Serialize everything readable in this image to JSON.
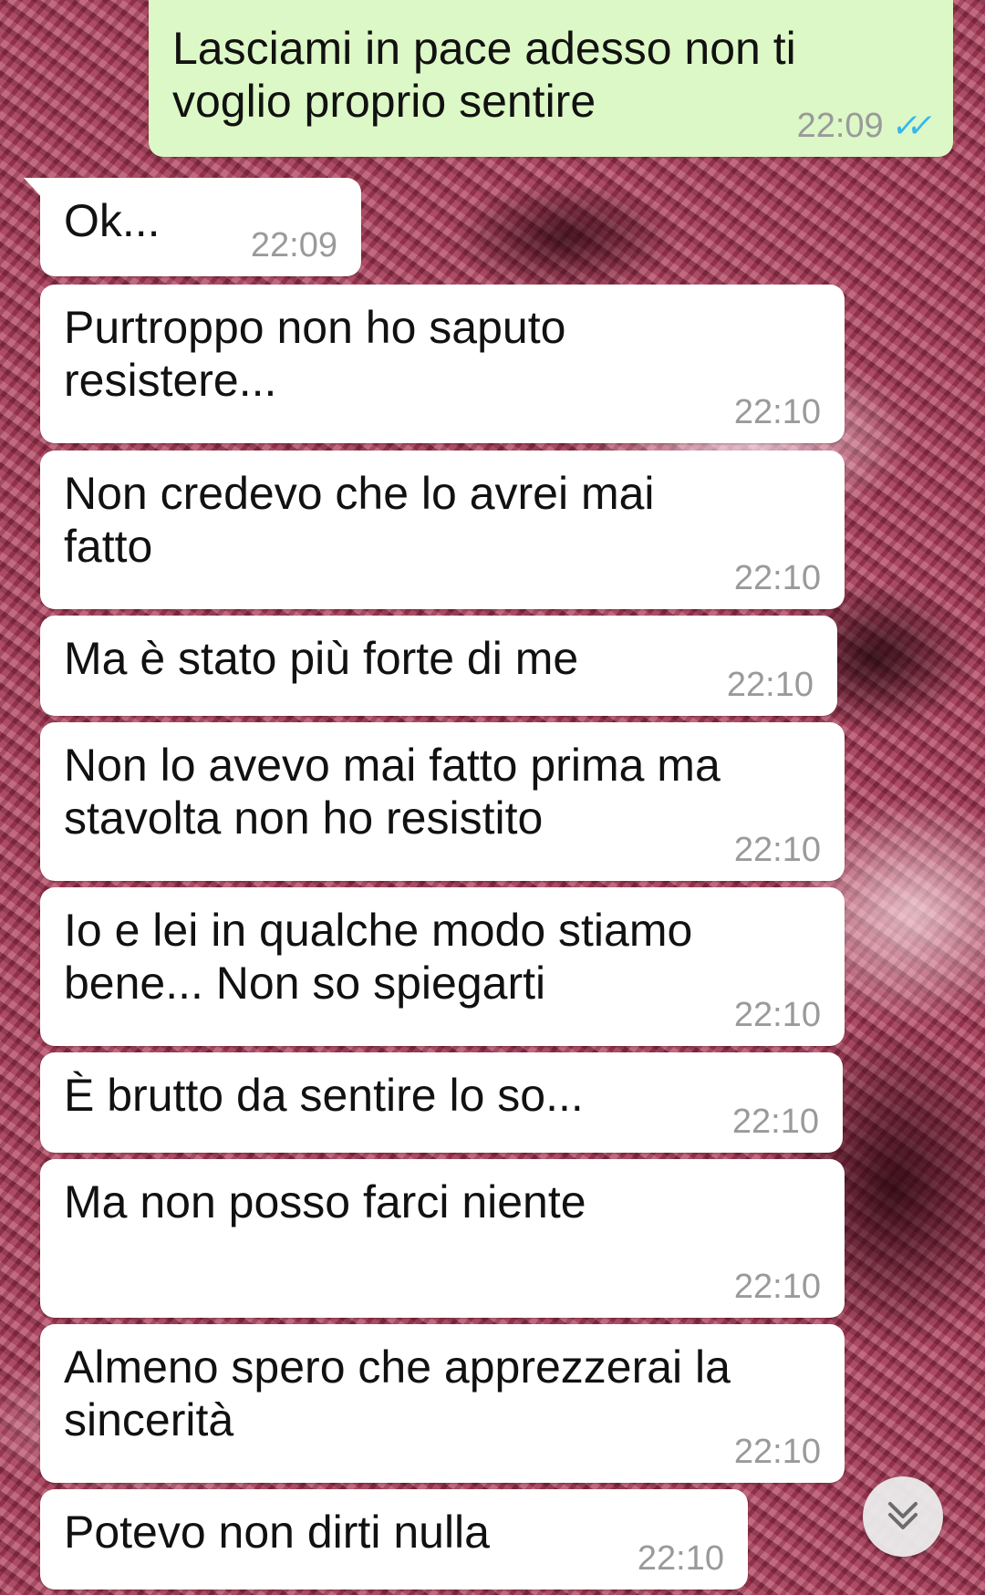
{
  "colors": {
    "outgoing_bubble": "#dcf8c6",
    "incoming_bubble": "#ffffff",
    "timestamp": "#9a9a9a",
    "read_ticks": "#34b7f1"
  },
  "messages": [
    {
      "direction": "outgoing",
      "text": "Lasciami in pace adesso non ti voglio proprio sentire",
      "time": "22:09",
      "status_icon": "double-check-read-icon"
    },
    {
      "direction": "incoming",
      "text": "Ok...",
      "time": "22:09"
    },
    {
      "direction": "incoming",
      "text": "Purtroppo non ho saputo resistere...",
      "time": "22:10"
    },
    {
      "direction": "incoming",
      "text": "Non credevo che lo avrei mai fatto",
      "time": "22:10"
    },
    {
      "direction": "incoming",
      "text": "Ma è stato più forte di me",
      "time": "22:10"
    },
    {
      "direction": "incoming",
      "text": "Non lo avevo mai fatto prima ma stavolta non ho resistito",
      "time": "22:10"
    },
    {
      "direction": "incoming",
      "text": "Io e lei in qualche modo stiamo bene... Non so spiegarti",
      "time": "22:10"
    },
    {
      "direction": "incoming",
      "text": "È brutto da sentire lo so...",
      "time": "22:10"
    },
    {
      "direction": "incoming",
      "text": "Ma non posso farci niente",
      "time": "22:10"
    },
    {
      "direction": "incoming",
      "text": "Almeno spero che apprezzerai la sincerità",
      "time": "22:10"
    },
    {
      "direction": "incoming",
      "text": "Potevo non dirti nulla",
      "time": "22:10"
    }
  ],
  "scroll_button_icon": "double-chevron-down-icon"
}
